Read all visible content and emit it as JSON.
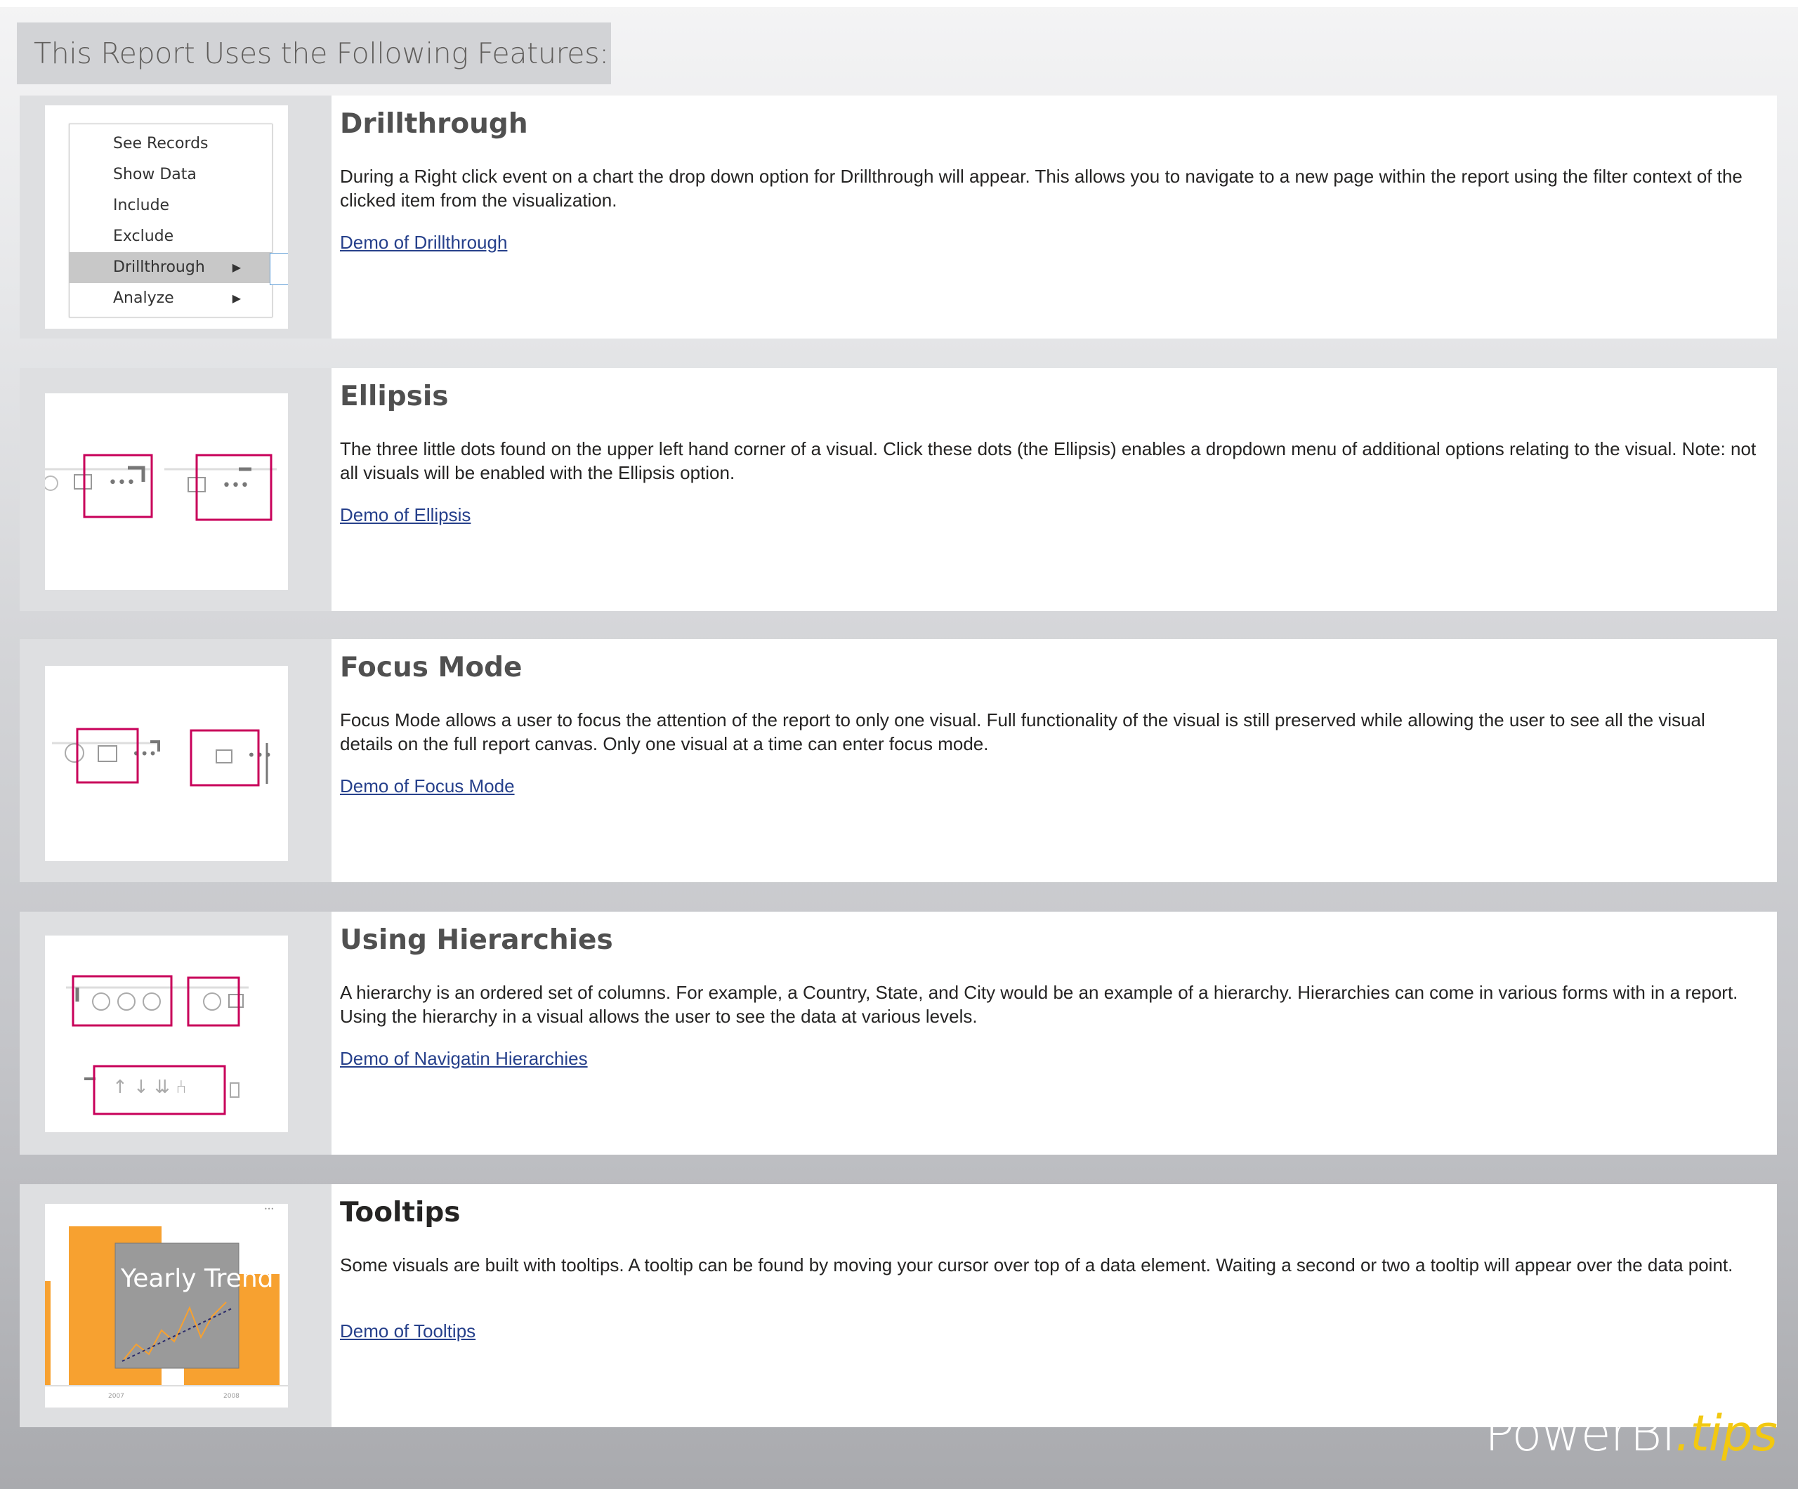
{
  "page": {
    "title": "This Report Uses the Following Features:",
    "watermark_main": "PowerBI",
    "watermark_accent": ".tips"
  },
  "sections": [
    {
      "heading": "Drillthrough",
      "description": "During a Right click event on a chart the drop down option for Drillthrough will appear.  This allows you to navigate to a new page within the report using the filter context of the clicked item from the visualization.",
      "link": "Demo of Drillthrough",
      "menu": [
        "See Records",
        "Show Data",
        "Include",
        "Exclude",
        "Drillthrough",
        "Analyze"
      ]
    },
    {
      "heading": "Ellipsis",
      "description": "The three little dots found on the upper left hand corner of a visual.  Click these dots (the Ellipsis) enables a dropdown menu of additional options relating to the visual.  Note: not all visuals will be enabled with the Ellipsis option.",
      "link": "Demo of Ellipsis"
    },
    {
      "heading": "Focus Mode",
      "description": "Focus Mode allows a user to focus the attention of the report to only one visual.  Full functionality of the visual is still preserved while allowing the user to see all the visual details on the full report canvas.  Only one visual at a time can enter focus mode.",
      "link": "Demo of Focus Mode"
    },
    {
      "heading": "Using Hierarchies",
      "description": "A hierarchy is an ordered set of columns.  For example, a Country, State, and City would be an example of a hierarchy.  Hierarchies can come in various forms with in a report.  Using the hierarchy in a visual allows the user to see the data at various levels.",
      "link": "Demo of Navigatin Hierarchies"
    },
    {
      "heading": "Tooltips",
      "description": "Some visuals are built with tooltips.  A tooltip can be found by moving your cursor over top of a data element.  Waiting a second or two a tooltip will appear over the data point.",
      "link": "Demo of Tooltips",
      "tooltip_title": "Yearly Trend",
      "axis_labels": [
        "2007",
        "2008"
      ]
    }
  ],
  "colors": {
    "orange": "#f7a130",
    "highlight": "#c8005a",
    "link": "#26408b",
    "heading": "#505050"
  }
}
